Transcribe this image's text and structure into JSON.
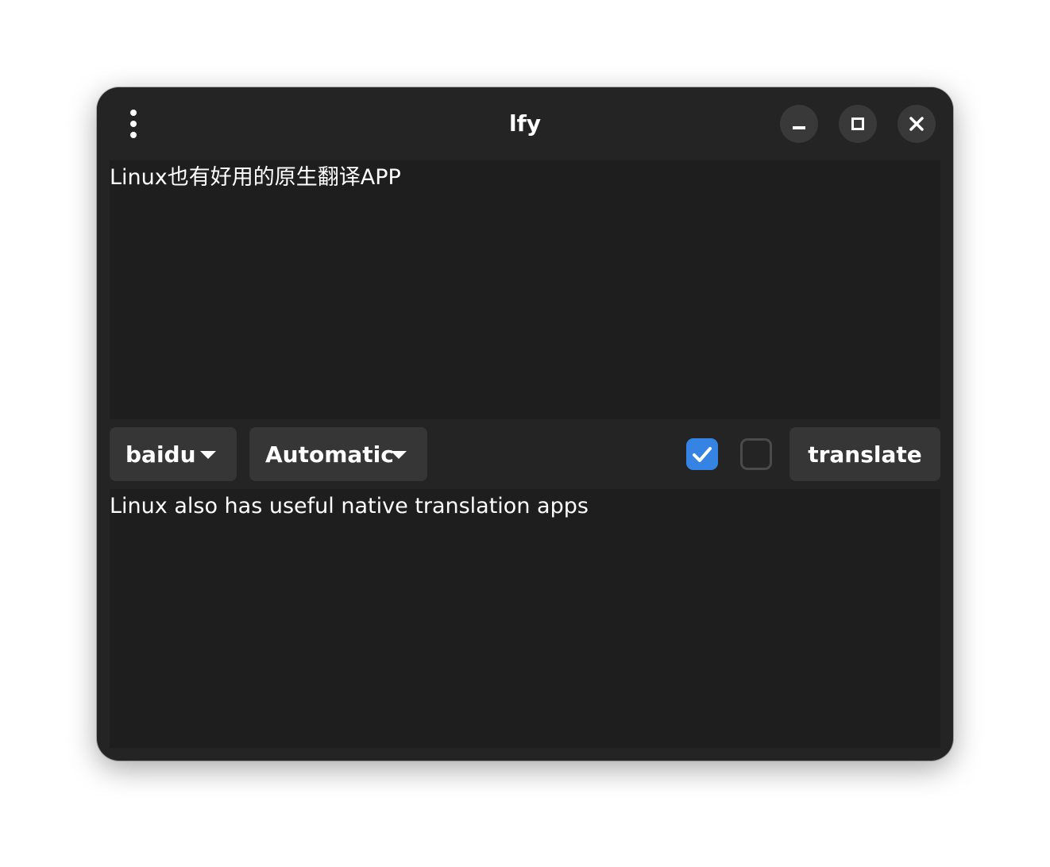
{
  "window": {
    "title": "lfy"
  },
  "source": {
    "text": "Linux也有好用的原生翻译APP"
  },
  "toolbar": {
    "engine_label": "baidu",
    "language_label": "Automatic",
    "checkbox1_checked": true,
    "checkbox2_checked": false,
    "translate_label": "translate"
  },
  "result": {
    "text": "Linux also has useful native translation apps"
  },
  "icons": {
    "menu": "kebab-menu-icon",
    "minimize": "minimize-icon",
    "maximize": "maximize-icon",
    "close": "close-icon",
    "dropdown": "chevron-down-icon",
    "check": "checkmark-icon"
  },
  "colors": {
    "accent": "#3584e4",
    "window_bg": "#242424",
    "pane_bg": "#1e1e1e",
    "button_bg": "#363636"
  }
}
